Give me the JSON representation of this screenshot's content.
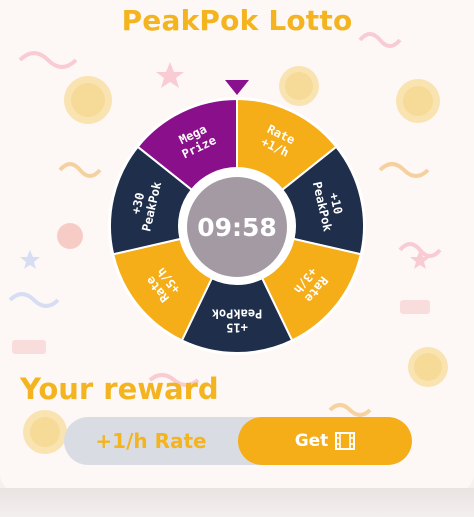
{
  "header": {
    "title": "PeakPok Lotto"
  },
  "wheel": {
    "segments": [
      {
        "label_lines": [
          "Mega",
          "Prize"
        ],
        "color": "#8a0f8b"
      },
      {
        "label_lines": [
          "Rate",
          "+1/h"
        ],
        "color": "#f5ad18"
      },
      {
        "label_lines": [
          "+10",
          "PeakPok"
        ],
        "color": "#1e2e4b"
      },
      {
        "label_lines": [
          "Rate",
          "+3/h"
        ],
        "color": "#f5ad18"
      },
      {
        "label_lines": [
          "+15",
          "PeakPok"
        ],
        "color": "#1e2e4b"
      },
      {
        "label_lines": [
          "Rate",
          "+5/h"
        ],
        "color": "#f5ad18"
      },
      {
        "label_lines": [
          "+30",
          "PeakPok"
        ],
        "color": "#1e2e4b"
      }
    ],
    "timer": "09:58"
  },
  "reward": {
    "heading": "Your reward",
    "value": "+1/h Rate",
    "get_label": "Get",
    "get_icon": "film-icon"
  },
  "colors": {
    "accent": "#f3b41f",
    "button": "#f5ad18",
    "navy": "#1e2e4b",
    "purple": "#8a0f8b",
    "timer_bg": "#a49aa3"
  }
}
